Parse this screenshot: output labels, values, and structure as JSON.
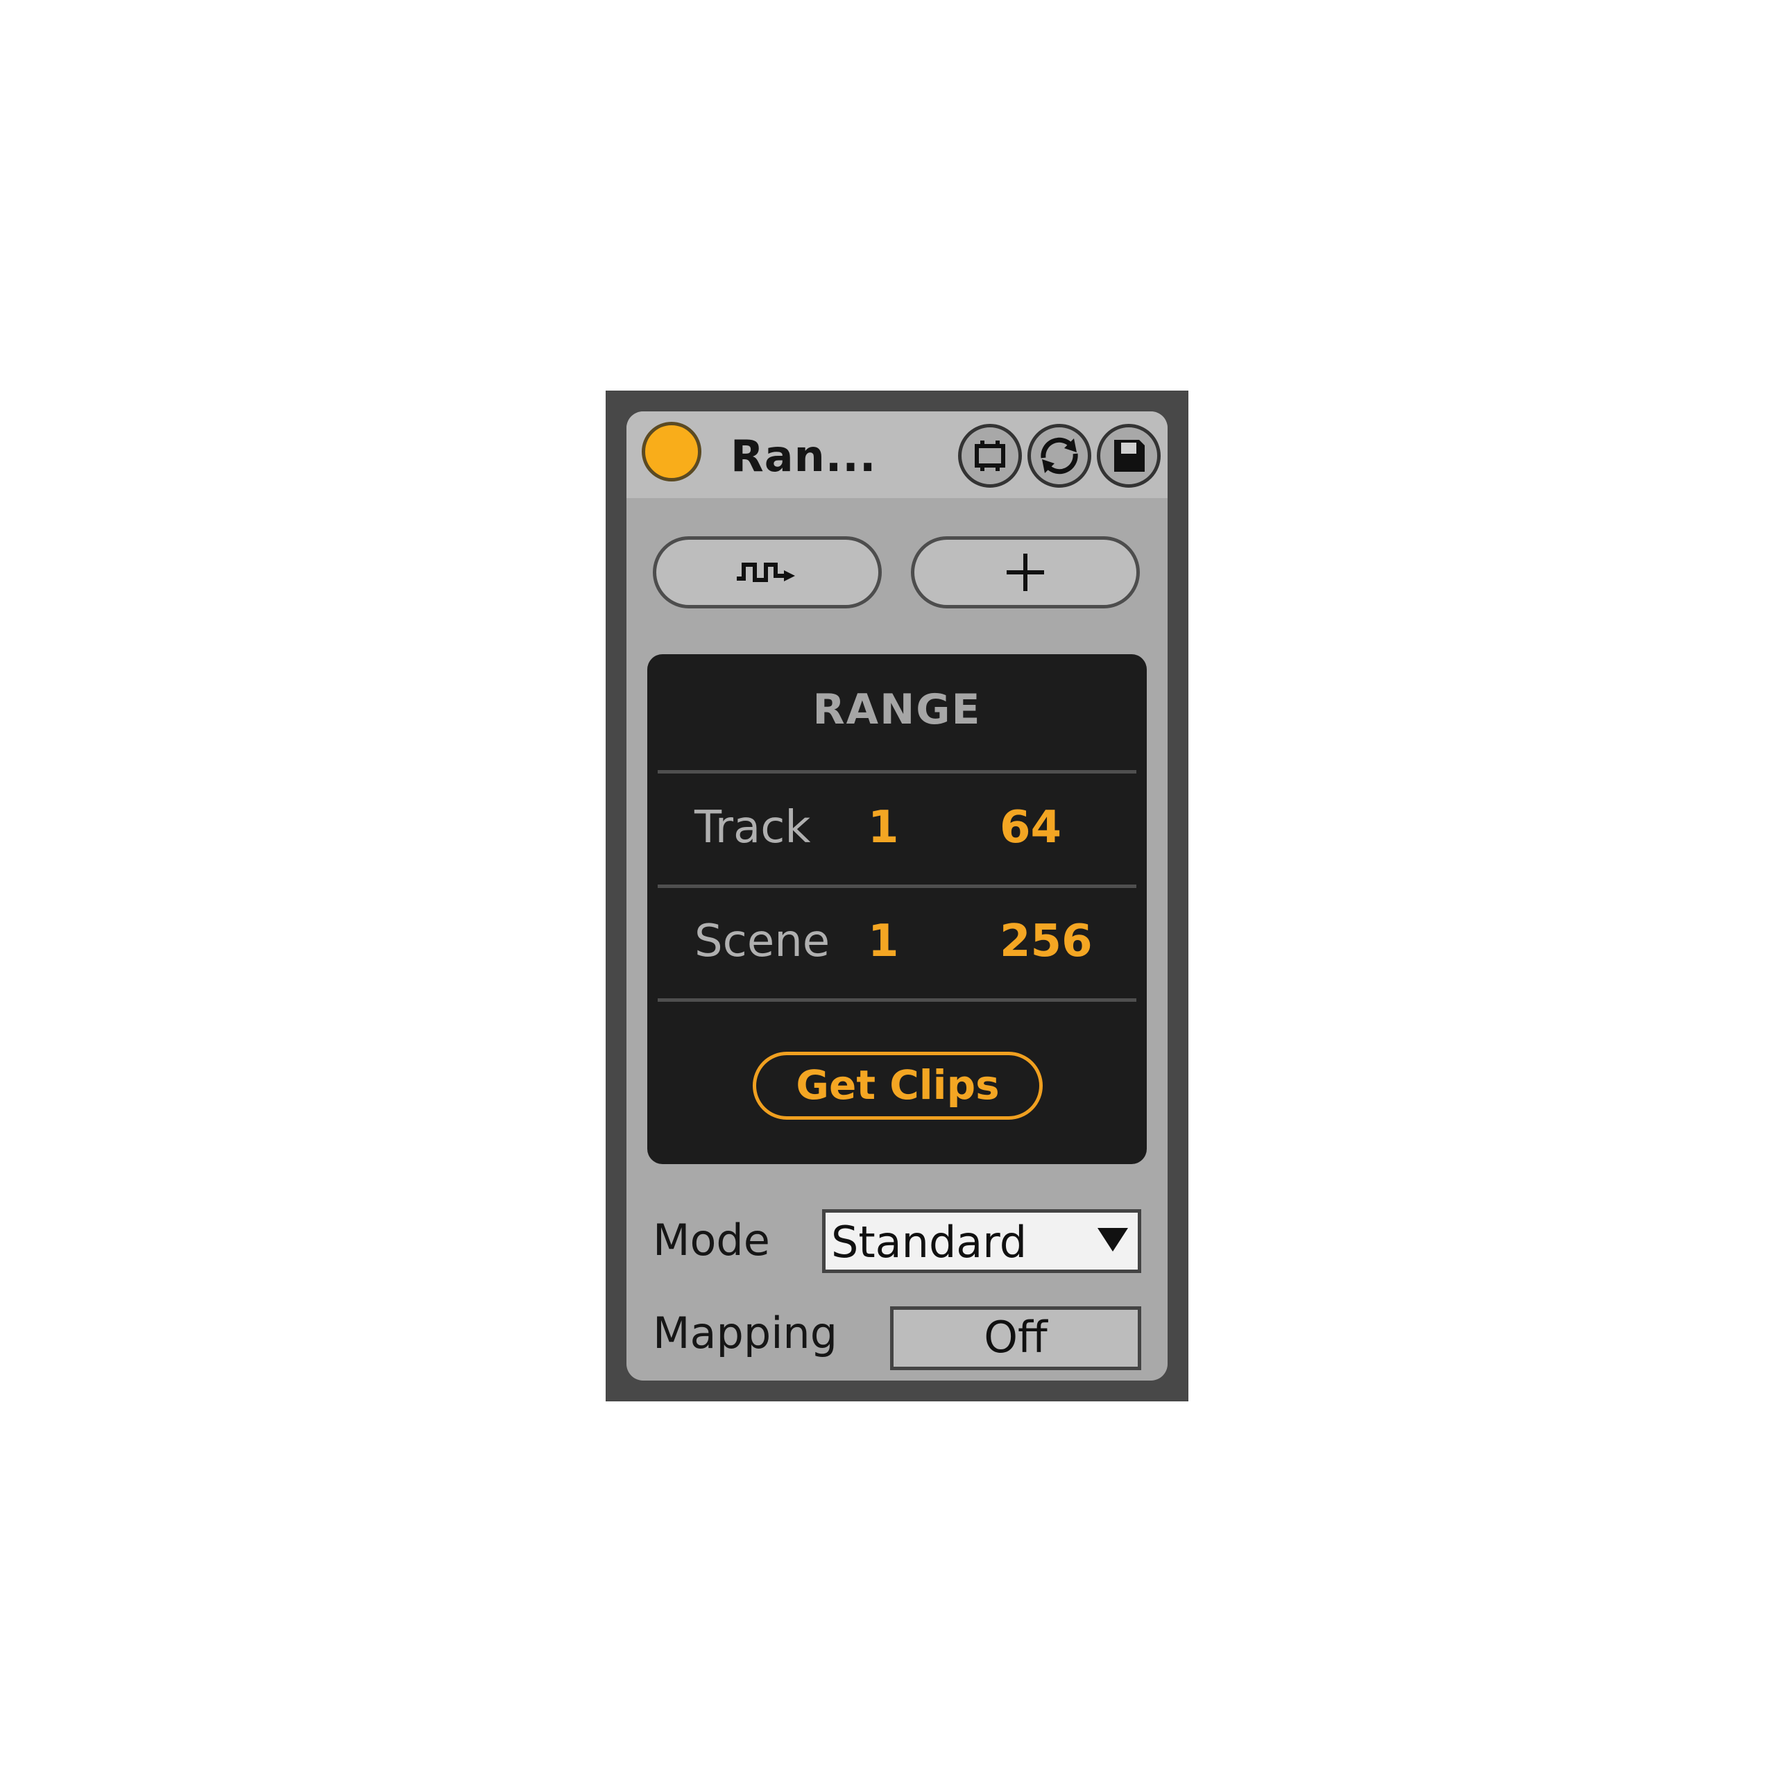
{
  "device": {
    "title": "Ran...",
    "accent_color": "#f4a623",
    "power_state": "on",
    "header_icons": [
      "clip-region-icon",
      "sync-icon",
      "save-icon"
    ]
  },
  "toolbar": {
    "left_button_icon": "waveform-arrow-icon",
    "right_button_icon": "plus-icon"
  },
  "range": {
    "title": "RANGE",
    "track": {
      "label": "Track",
      "from": "1",
      "to": "64"
    },
    "scene": {
      "label": "Scene",
      "from": "1",
      "to": "256"
    },
    "action_label": "Get Clips"
  },
  "mode": {
    "label": "Mode",
    "selected": "Standard"
  },
  "mapping": {
    "label": "Mapping",
    "value": "Off"
  }
}
